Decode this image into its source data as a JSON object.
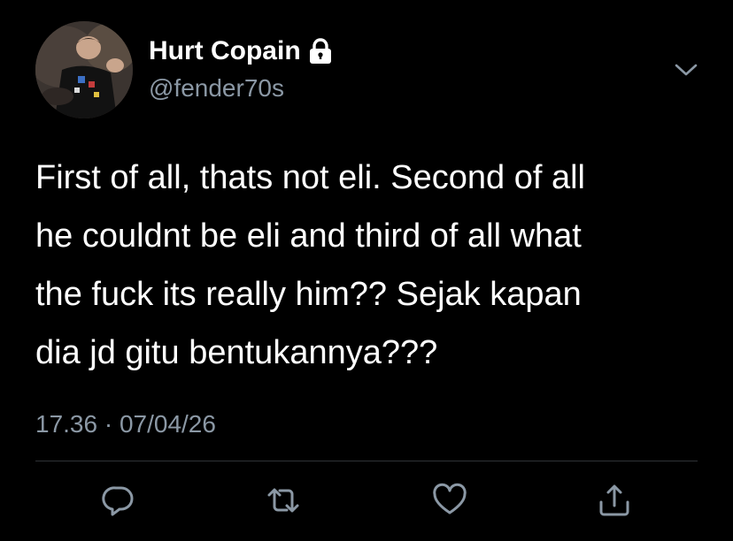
{
  "author": {
    "name": "Hurt Copain",
    "handle": "@fender70s",
    "avatar_icon": "profile-photo",
    "protected_icon": "lock-icon"
  },
  "tweet": {
    "lines": [
      "First of all, thats not eli. Second of all",
      "he couldnt be eli and third of all what",
      "the fuck its really him?? Sejak kapan",
      "dia jd gitu bentukannya???"
    ],
    "timestamp": "17.36 · 07/04/26"
  },
  "menu": {
    "icon": "chevron-down-icon"
  },
  "actions": [
    {
      "name": "reply",
      "icon": "speech-bubble-icon"
    },
    {
      "name": "retweet",
      "icon": "retweet-arrows-icon"
    },
    {
      "name": "like",
      "icon": "heart-icon"
    },
    {
      "name": "share",
      "icon": "share-upload-icon"
    }
  ],
  "colors": {
    "background": "#000000",
    "text_primary": "#ffffff",
    "text_secondary": "#8b98a5",
    "icon": "#8b98a5",
    "divider": "#2f3336"
  }
}
